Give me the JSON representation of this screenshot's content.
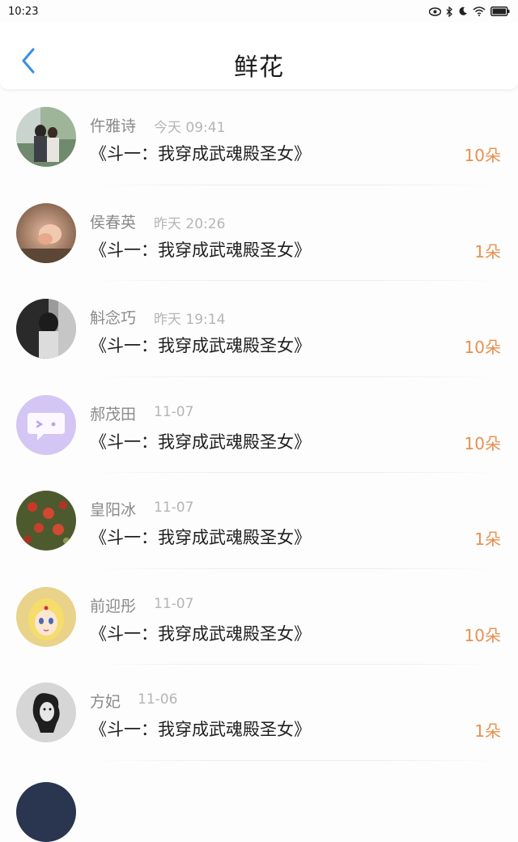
{
  "status_bar": {
    "time": "10:23"
  },
  "header": {
    "title": "鲜花"
  },
  "colors": {
    "count": "#e8904f",
    "accent": "#3a8ee6"
  },
  "items": [
    {
      "user": "仵雅诗",
      "time": "今天 09:41",
      "book": "《斗一：我穿成武魂殿圣女》",
      "count": "10朵"
    },
    {
      "user": "侯春英",
      "time": "昨天 20:26",
      "book": "《斗一：我穿成武魂殿圣女》",
      "count": "1朵"
    },
    {
      "user": "斛念巧",
      "time": "昨天 19:14",
      "book": "《斗一：我穿成武魂殿圣女》",
      "count": "10朵"
    },
    {
      "user": "郝茂田",
      "time": "11-07",
      "book": "《斗一：我穿成武魂殿圣女》",
      "count": "10朵"
    },
    {
      "user": "皇阳冰",
      "time": "11-07",
      "book": "《斗一：我穿成武魂殿圣女》",
      "count": "1朵"
    },
    {
      "user": "前迎彤",
      "time": "11-07",
      "book": "《斗一：我穿成武魂殿圣女》",
      "count": "10朵"
    },
    {
      "user": "方妃",
      "time": "11-06",
      "book": "《斗一：我穿成武魂殿圣女》",
      "count": "1朵"
    }
  ]
}
